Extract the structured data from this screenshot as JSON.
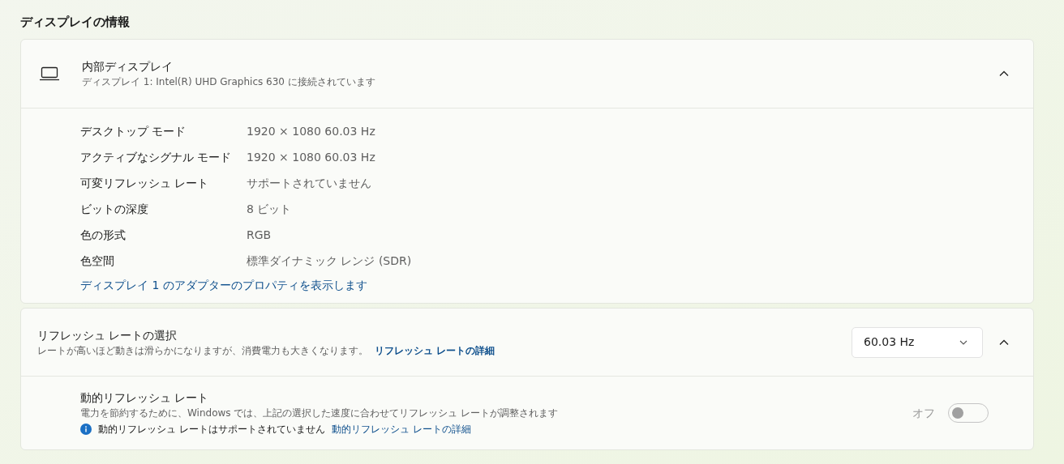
{
  "section_title": "ディスプレイの情報",
  "display_card": {
    "title": "内部ディスプレイ",
    "subtitle": "ディスプレイ 1: Intel(R) UHD Graphics 630 に接続されています",
    "expanded": true,
    "properties": [
      {
        "label": "デスクトップ モード",
        "value": "1920 × 1080 60.03 Hz"
      },
      {
        "label": "アクティブなシグナル モード",
        "value": "1920 × 1080 60.03 Hz"
      },
      {
        "label": "可変リフレッシュ レート",
        "value": "サポートされていません"
      },
      {
        "label": "ビットの深度",
        "value": "8 ビット"
      },
      {
        "label": "色の形式",
        "value": "RGB"
      },
      {
        "label": "色空間",
        "value": "標準ダイナミック レンジ (SDR)"
      }
    ],
    "link": "ディスプレイ 1 のアダプターのプロパティを表示します"
  },
  "refresh_card": {
    "title": "リフレッシュ レートの選択",
    "description": "レートが高いほど動きは滑らかになりますが、消費電力も大きくなります。",
    "link": "リフレッシュ レートの詳細",
    "dropdown_value": "60.03 Hz",
    "expanded": true,
    "dynamic": {
      "title": "動的リフレッシュ レート",
      "description": "電力を節約するために、Windows では、上記の選択した速度に合わせてリフレッシュ レートが調整されます",
      "info": "動的リフレッシュ レートはサポートされていません",
      "link": "動的リフレッシュ レートの詳細",
      "toggle_label": "オフ",
      "on": false,
      "disabled": true
    }
  }
}
